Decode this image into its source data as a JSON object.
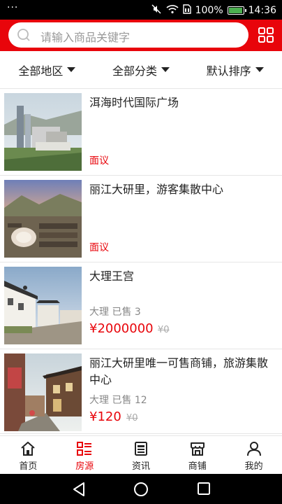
{
  "status_bar": {
    "dots": "···",
    "battery_pct": "100%",
    "battery_level": 1.0,
    "time": "14:36"
  },
  "search": {
    "placeholder": "请输入商品关键字"
  },
  "filters": [
    {
      "label": "全部地区"
    },
    {
      "label": "全部分类"
    },
    {
      "label": "默认排序"
    }
  ],
  "listings": [
    {
      "title": "洱海时代国际广场",
      "price_note": "面议"
    },
    {
      "title": "丽江大研里，游客集散中心",
      "price_note": "面议"
    },
    {
      "title": "大理王宫",
      "meta": "大理 已售 3",
      "price": "¥2000000",
      "old_price": "¥0"
    },
    {
      "title": "丽江大研里唯一可售商铺，旅游集散中心",
      "meta": "大理 已售 12",
      "price": "¥120",
      "old_price": "¥0"
    }
  ],
  "tabs": [
    {
      "label": "首页",
      "icon": "home-icon"
    },
    {
      "label": "房源",
      "icon": "list-icon",
      "active": true
    },
    {
      "label": "资讯",
      "icon": "news-icon"
    },
    {
      "label": "商铺",
      "icon": "shop-icon"
    },
    {
      "label": "我的",
      "icon": "profile-icon"
    }
  ],
  "colors": {
    "brand_red": "#e8050b",
    "price_red": "#e8050b",
    "battery_green": "#4caf50"
  }
}
